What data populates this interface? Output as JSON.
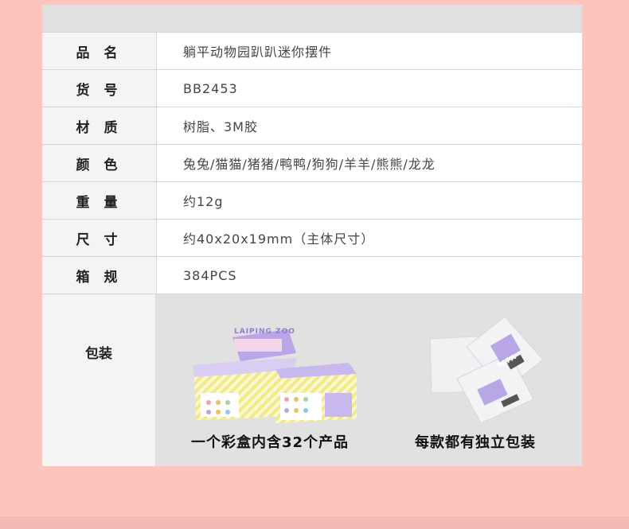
{
  "specs": [
    {
      "label": "品 名",
      "value": "躺平动物园趴趴迷你摆件"
    },
    {
      "label": "货 号",
      "value": "BB2453"
    },
    {
      "label": "材 质",
      "value": "树脂、3M胶"
    },
    {
      "label": "颜 色",
      "value": "兔兔/猫猫/猪猪/鸭鸭/狗狗/羊羊/熊熊/龙龙"
    },
    {
      "label": "重 量",
      "value": "约12g"
    },
    {
      "label": "尺 寸",
      "value": "约40x20x19mm（主体尺寸）"
    },
    {
      "label": "箱 规",
      "value": "384PCS"
    }
  ],
  "packaging": {
    "label": "包装",
    "box_caption": "一个彩盒内含32个产品",
    "bag_caption": "每款都有独立包装",
    "box_logo": "LAIPING ZOO",
    "bag_logo": "PAPA"
  },
  "colors": {
    "background": "#fdc4bc",
    "box_purple": "#b9a6e6",
    "box_yellow": "#f4ef9a"
  }
}
